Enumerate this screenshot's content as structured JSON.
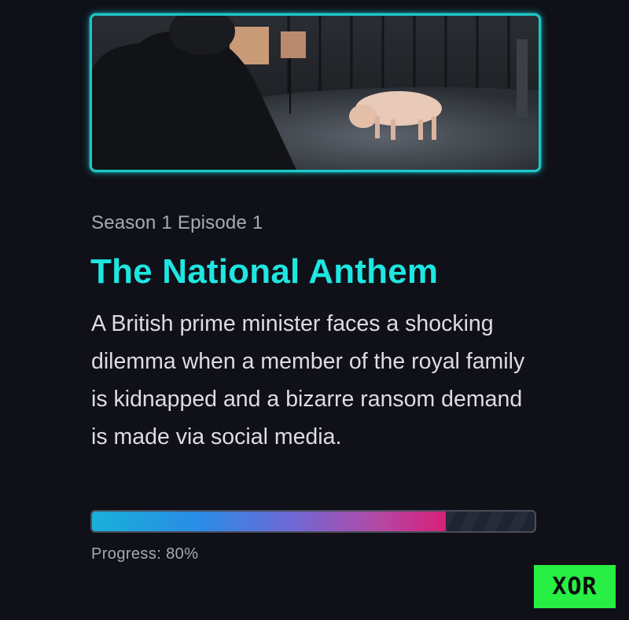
{
  "thumbnail": {
    "icon": "episode-still-image"
  },
  "episode": {
    "label": "Season 1 Episode 1",
    "title": "The National Anthem",
    "description": "A British prime minister faces a shocking dilemma when a member of the royal family is kidnapped and a bizarre ransom demand is made via social media."
  },
  "progress": {
    "value": 0.8,
    "label": "Progress: 80%"
  },
  "badge": {
    "text": "XOR"
  },
  "colors": {
    "background": "#101019",
    "accent": "#1ee6e0",
    "badge": "#27ef43"
  }
}
